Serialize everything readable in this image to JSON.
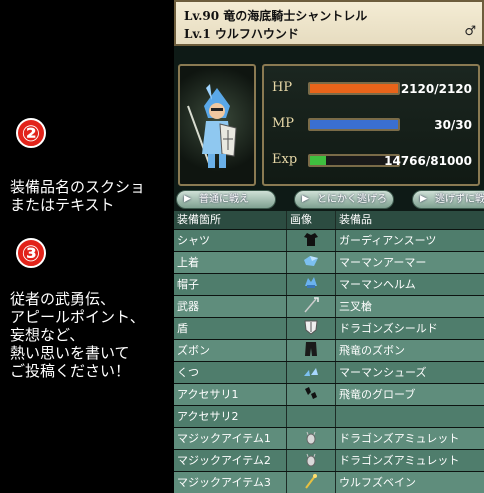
{
  "left": {
    "badge2": "②",
    "text2": "装備品名のスクショ\nまたはテキスト",
    "badge3": "③",
    "text3": "従者の武勇伝、\nアピールポイント、\n妄想など、\n熱い思いを書いて\nご投稿ください！"
  },
  "header": {
    "line1": "Lv.90 竜の海底騎士シャントレル",
    "line2": "Lv.1 ウルフハウンド",
    "gender": "♂"
  },
  "stats": {
    "hp": {
      "label": "HP",
      "value": "2120/2120",
      "fill": 1.0,
      "color": "#e8641a"
    },
    "mp": {
      "label": "MP",
      "value": "30/30",
      "fill": 1.0,
      "color": "#3a6fd0"
    },
    "exp": {
      "label": "Exp",
      "value": "14766/81000",
      "fill": 0.18,
      "color": "#3fbf3f"
    }
  },
  "buttons": [
    "普通に戦え",
    "とにかく逃げろ",
    "逃げずに戦"
  ],
  "table": {
    "headers": [
      "装備箇所",
      "画像",
      "装備品"
    ],
    "rows": [
      {
        "slot": "シャツ",
        "icon": "shirt-icon",
        "item": "ガーディアンスーツ"
      },
      {
        "slot": "上着",
        "icon": "armor-icon",
        "item": "マーマンアーマー"
      },
      {
        "slot": "帽子",
        "icon": "helm-icon",
        "item": "マーマンヘルム"
      },
      {
        "slot": "武器",
        "icon": "spear-icon",
        "item": "三叉槍"
      },
      {
        "slot": "盾",
        "icon": "shield-icon",
        "item": "ドラゴンズシールド"
      },
      {
        "slot": "ズボン",
        "icon": "pants-icon",
        "item": "飛竜のズボン"
      },
      {
        "slot": "くつ",
        "icon": "shoes-icon",
        "item": "マーマンシューズ"
      },
      {
        "slot": "アクセサリ1",
        "icon": "glove-icon",
        "item": "飛竜のグローブ"
      },
      {
        "slot": "アクセサリ2",
        "icon": "",
        "item": ""
      },
      {
        "slot": "マジックアイテム1",
        "icon": "amulet-icon",
        "item": "ドラゴンズアミュレット"
      },
      {
        "slot": "マジックアイテム2",
        "icon": "amulet-icon",
        "item": "ドラゴンズアミュレット"
      },
      {
        "slot": "マジックアイテム3",
        "icon": "fang-icon",
        "item": "ウルフズベイン"
      }
    ]
  }
}
